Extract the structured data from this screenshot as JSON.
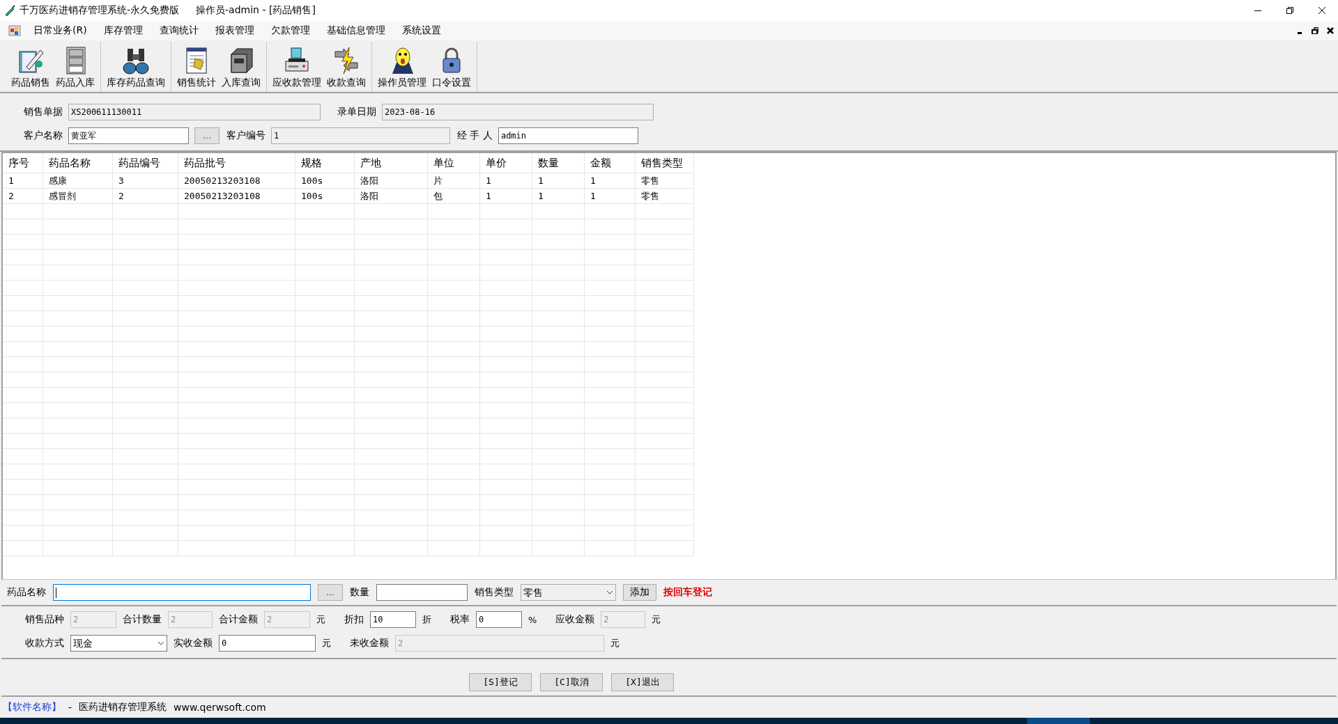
{
  "window": {
    "title": "千万医药进销存管理系统-永久免费版",
    "subtitle": "操作员-admin - [药品销售]"
  },
  "menu": [
    {
      "label": "日常业务(R)"
    },
    {
      "label": "库存管理"
    },
    {
      "label": "查询统计"
    },
    {
      "label": "报表管理"
    },
    {
      "label": "欠款管理"
    },
    {
      "label": "基础信息管理"
    },
    {
      "label": "系统设置"
    }
  ],
  "toolbar": [
    [
      {
        "label": "药品销售"
      },
      {
        "label": "药品入库"
      }
    ],
    [
      {
        "label": "库存药品查询"
      }
    ],
    [
      {
        "label": "销售统计"
      },
      {
        "label": "入库查询"
      }
    ],
    [
      {
        "label": "应收款管理"
      },
      {
        "label": "收款查询"
      }
    ],
    [
      {
        "label": "操作员管理"
      },
      {
        "label": "口令设置"
      }
    ]
  ],
  "form": {
    "rows": [
      [
        {
          "label": "销售单据",
          "value": "XS200611130011",
          "readonly": true,
          "kind": "field"
        },
        {
          "label": "录单日期",
          "value": "2023-08-16",
          "readonly": true,
          "kind": "field"
        }
      ],
      [
        {
          "label": "客户名称",
          "value": "黄亚军",
          "readonly": false,
          "kind": "picker",
          "button": "..."
        },
        {
          "label": "客户编号",
          "value": "1",
          "readonly": true,
          "kind": "field"
        },
        {
          "label": "经 手 人",
          "value": "admin",
          "readonly": false,
          "kind": "field"
        }
      ]
    ]
  },
  "table": {
    "columns": [
      "序号",
      "药品名称",
      "药品编号",
      "药品批号",
      "规格",
      "产地",
      "单位",
      "单价",
      "数量",
      "金额",
      "销售类型"
    ],
    "rows": [
      [
        "1",
        "感康",
        "3",
        "20050213203108",
        "100s",
        "洛阳",
        "片",
        "1",
        "1",
        "1",
        "零售"
      ],
      [
        "2",
        "感冒剂",
        "2",
        "20050213203108",
        "100s",
        "洛阳",
        "包",
        "1",
        "1",
        "1",
        "零售"
      ]
    ]
  },
  "entry": {
    "name_label": "药品名称",
    "name_focused": true,
    "browse_button": "...",
    "qty_label": "数量",
    "type_label": "销售类型",
    "type_value": "零售",
    "add_button": "添加",
    "hint": "按回车登记"
  },
  "totals": {
    "fields": [
      {
        "label": "销售品种",
        "value": "2",
        "disabled": true,
        "kind": "field"
      },
      {
        "label": "合计数量",
        "value": "2",
        "disabled": true,
        "kind": "field"
      },
      {
        "label": "合计金额",
        "value": "2",
        "disabled": true,
        "kind": "field",
        "unit": "元"
      },
      {
        "label": "折扣",
        "value": "10",
        "disabled": false,
        "kind": "field",
        "unit": "折"
      },
      {
        "label": "税率",
        "value": "0",
        "disabled": false,
        "kind": "field",
        "unit": "%"
      },
      {
        "label": "应收金额",
        "value": "2",
        "disabled": true,
        "kind": "field",
        "unit": "元"
      },
      {
        "label": "收款方式",
        "value": "现金",
        "disabled": false,
        "kind": "select"
      },
      {
        "label": "实收金额",
        "value": "0",
        "disabled": false,
        "kind": "field",
        "unit": "元"
      },
      {
        "label": "未收金额",
        "value": "2",
        "disabled": true,
        "kind": "field",
        "unit": "元"
      }
    ]
  },
  "actions": [
    {
      "label": "[S]登记"
    },
    {
      "label": "[C]取消"
    },
    {
      "label": "[X]退出"
    }
  ],
  "status_bar": {
    "name": "【软件名称】",
    "separator": "-",
    "product": "医药进销存管理系统",
    "website": "www.qerwsoft.com"
  }
}
